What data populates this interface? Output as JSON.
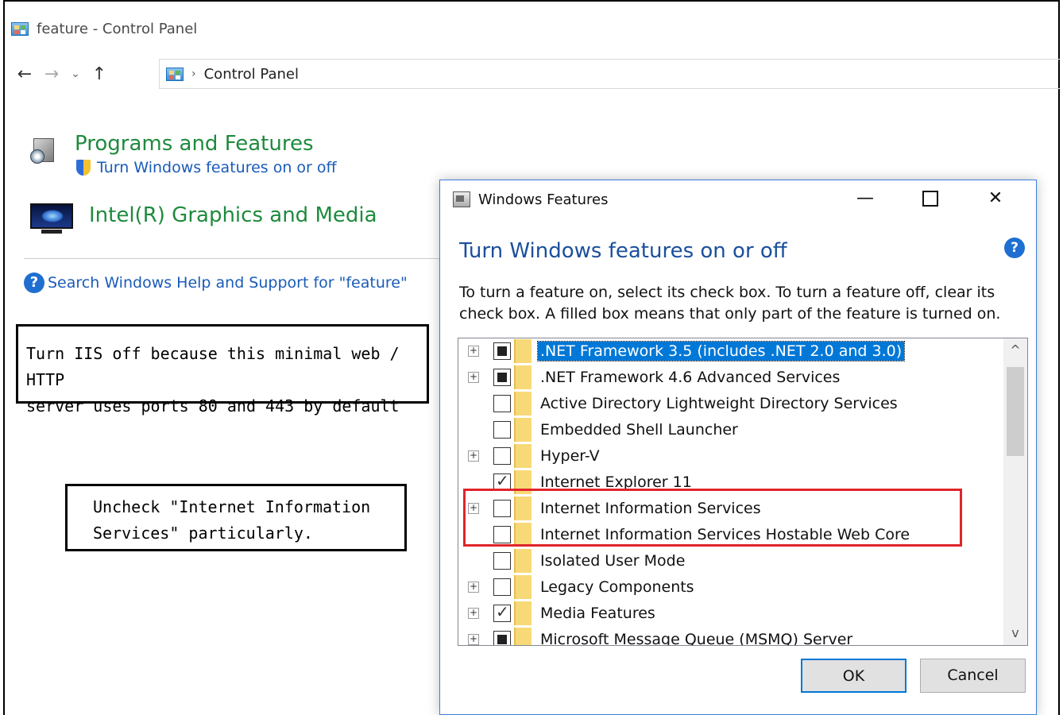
{
  "window": {
    "title": "feature - Control Panel"
  },
  "nav": {
    "back": "←",
    "forward": "→",
    "recent": "⌄",
    "up": "↑",
    "separator": "›",
    "crumb": "Control Panel"
  },
  "results": [
    {
      "title": "Programs and Features",
      "link": "Turn Windows features on or off"
    },
    {
      "title": "Intel(R) Graphics and Media"
    }
  ],
  "help": {
    "icon": "?",
    "link": "Search Windows Help and Support for \"feature\""
  },
  "annotations": {
    "note1": {
      "line1": "Turn IIS off because this minimal web / HTTP",
      "line2": "server uses ports 80 and 443 by default"
    },
    "note2": {
      "line1": "Uncheck \"Internet Information",
      "line2": "Services\" particularly."
    }
  },
  "dialog": {
    "title": "Windows Features",
    "controls": {
      "minimize": "—",
      "close": "✕"
    },
    "heading": "Turn Windows features on or off",
    "help_icon": "?",
    "description_line1": "To turn a feature on, select its check box. To turn a feature off, clear its",
    "description_line2": "check box. A filled box means that only part of the feature is turned on.",
    "features": [
      {
        "label": ".NET Framework 3.5 (includes .NET 2.0 and 3.0)",
        "state": "partial",
        "expandable": true,
        "selected": true
      },
      {
        "label": ".NET Framework 4.6 Advanced Services",
        "state": "partial",
        "expandable": true,
        "selected": false
      },
      {
        "label": "Active Directory Lightweight Directory Services",
        "state": "off",
        "expandable": false,
        "selected": false
      },
      {
        "label": "Embedded Shell Launcher",
        "state": "off",
        "expandable": false,
        "selected": false
      },
      {
        "label": "Hyper-V",
        "state": "off",
        "expandable": true,
        "selected": false
      },
      {
        "label": "Internet Explorer 11",
        "state": "on",
        "expandable": false,
        "selected": false
      },
      {
        "label": "Internet Information Services",
        "state": "off",
        "expandable": true,
        "selected": false
      },
      {
        "label": "Internet Information Services Hostable Web Core",
        "state": "off",
        "expandable": false,
        "selected": false
      },
      {
        "label": "Isolated User Mode",
        "state": "off",
        "expandable": false,
        "selected": false
      },
      {
        "label": "Legacy Components",
        "state": "off",
        "expandable": true,
        "selected": false
      },
      {
        "label": "Media Features",
        "state": "on",
        "expandable": true,
        "selected": false
      },
      {
        "label": "Microsoft Message Queue (MSMQ) Server",
        "state": "partial",
        "expandable": true,
        "selected": false
      }
    ],
    "expand_glyph": "+",
    "scroll": {
      "up": "^",
      "down": "v"
    },
    "buttons": {
      "ok": "OK",
      "cancel": "Cancel"
    }
  },
  "colors": {
    "result_title": "#1e8a3d",
    "link": "#1a5bb8",
    "heading": "#1a4f9c",
    "selection": "#0078d7",
    "highlight": "#e0242a"
  }
}
